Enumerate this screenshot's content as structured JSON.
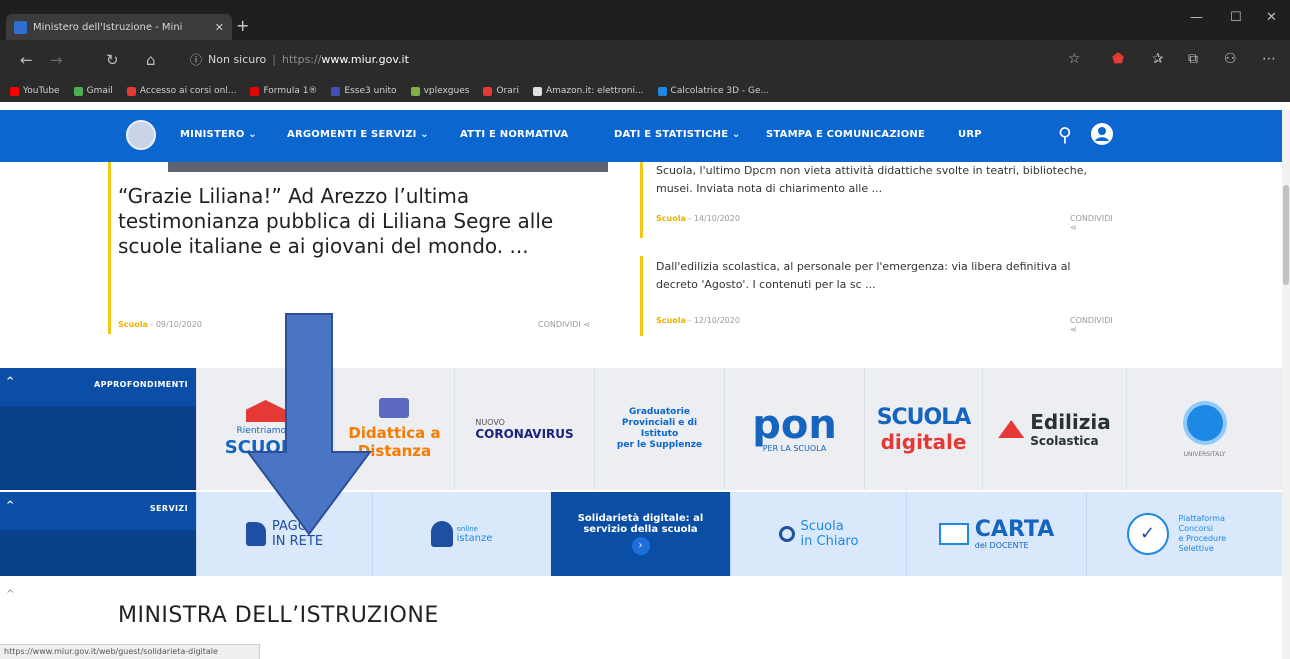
{
  "browser": {
    "tab_title": "Ministero dell'Istruzione - Mini",
    "address": {
      "security": "Non sicuro",
      "url_prefix": "https://",
      "url_domain": "www.miur.gov.it"
    },
    "favorites": [
      {
        "label": "YouTube",
        "color": "#ff0000"
      },
      {
        "label": "Gmail",
        "color": "#4caf50"
      },
      {
        "label": "Accesso ai corsi onl...",
        "color": "#e53935"
      },
      {
        "label": "Formula 1®",
        "color": "#e10600"
      },
      {
        "label": "Esse3 unito",
        "color": "#3f51b5"
      },
      {
        "label": "vplexgues",
        "color": "#7cb342"
      },
      {
        "label": "Orari",
        "color": "#e53935"
      },
      {
        "label": "Amazon.it: elettroni...",
        "color": "#e0e0e0"
      },
      {
        "label": "Calcolatrice 3D - Ge...",
        "color": "#1e88e5"
      }
    ],
    "status_url": "https://www.miur.gov.it/web/guest/solidarieta-digitale"
  },
  "nav": {
    "items": [
      "MINISTERO ⌄",
      "ARGOMENTI E SERVIZI ⌄",
      "ATTI E NORMATIVA",
      "DATI E STATISTICHE ⌄",
      "STAMPA E COMUNICAZIONE",
      "URP"
    ]
  },
  "news": {
    "main": {
      "title": "“Grazie Liliana!” Ad Arezzo l’ultima testimonianza pubblica di Liliana Segre alle scuole italiane e ai giovani del mondo. ...",
      "category": "Scuola",
      "date": " - 09/10/2020",
      "share": "CONDIVIDI"
    },
    "items": [
      {
        "text": "Scuola, l'ultimo Dpcm non vieta attività didattiche svolte in teatri, biblioteche, musei. Inviata nota di chiarimento alle ...",
        "category": "Scuola",
        "date": " - 14/10/2020",
        "share": "CONDIVIDI"
      },
      {
        "text": "Dall'edilizia scolastica, al personale per l'emergenza: via libera definitiva al decreto 'Agosto'. I contenuti per la sc ...",
        "category": "Scuola",
        "date": " - 12/10/2020",
        "share": "CONDIVIDI"
      }
    ]
  },
  "approfondimenti": {
    "label": "APPROFONDIMENTI",
    "tiles": [
      {
        "line1": "Rientriamo a",
        "line2": "SCUOLA"
      },
      {
        "line1": "Didattica a",
        "line2": "Distanza"
      },
      {
        "line1": "NUOVO",
        "line2": "CORONAVIRUS"
      },
      {
        "line1": "Graduatorie Provinciali e di Istituto",
        "line2": "per le Supplenze"
      },
      {
        "line1": "pon",
        "line2": "PER LA SCUOLA"
      },
      {
        "line1": "SCUOLA",
        "line2": "digitale"
      },
      {
        "line1": "Edilizia",
        "line2": "Scolastica"
      },
      {
        "line1": "",
        "line2": "UNIVERSITALY"
      }
    ]
  },
  "servizi": {
    "label": "SERVIZI",
    "tiles": [
      {
        "line1": "PAGO",
        "line2": "IN RETE"
      },
      {
        "line1": "online",
        "line2": "istanze"
      },
      {
        "line1": "Solidarietà digitale: al",
        "line2": "servizio della scuola"
      },
      {
        "line1": "Scuola",
        "line2": "in Chiaro"
      },
      {
        "line1": "CARTA",
        "line2": "del DOCENTE"
      },
      {
        "line1": "Piattaforma Concorsi",
        "line2": "e Procedure Selettive"
      }
    ]
  },
  "section_title": "MINISTRA DELL’ISTRUZIONE",
  "colors": {
    "site_blue": "#0b66d0",
    "accent_yellow": "#f5c518",
    "arrow": "#4a74c4"
  }
}
